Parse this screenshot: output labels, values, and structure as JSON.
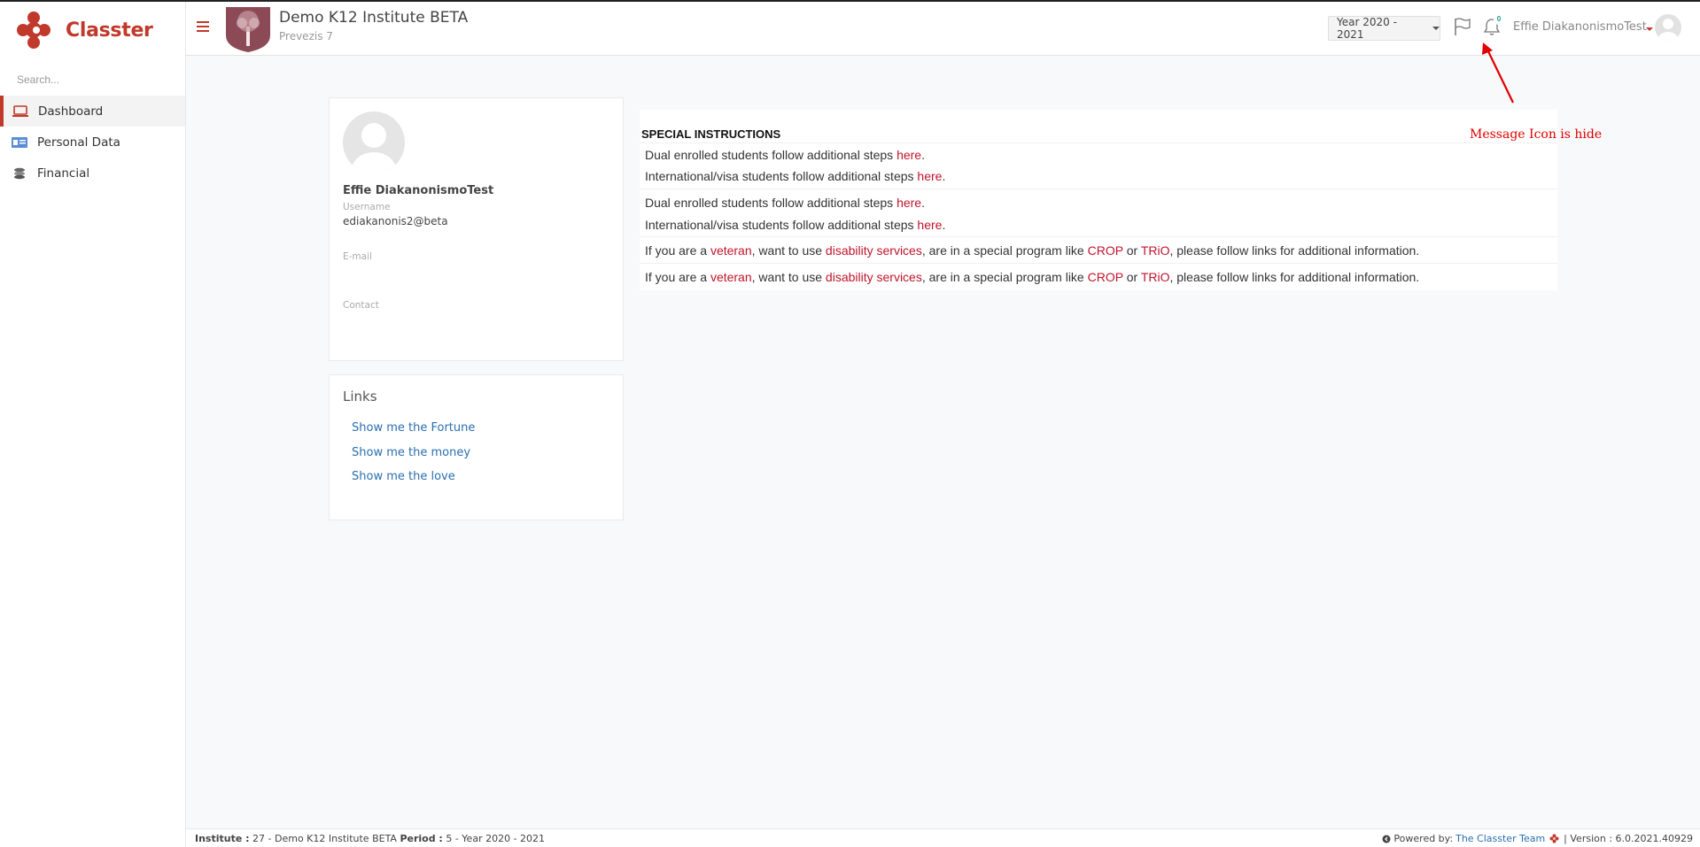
{
  "brand": {
    "name": "Classter"
  },
  "sidebar": {
    "search_placeholder": "Search...",
    "items": [
      {
        "label": "Dashboard",
        "icon": "laptop-icon",
        "active": true
      },
      {
        "label": "Personal Data",
        "icon": "id-card-icon",
        "active": false
      },
      {
        "label": "Financial",
        "icon": "coins-icon",
        "active": false
      }
    ]
  },
  "header": {
    "institute_name": "Demo K12 Institute BETA",
    "institute_address": "Prevezis 7",
    "year_selected": "Year 2020 - 2021",
    "notifications_count": "0",
    "user_name": "Effie DiakanonismoTest"
  },
  "profile": {
    "name": "Effie DiakanonismoTest",
    "username_label": "Username",
    "username": "ediakanonis2@beta",
    "email_label": "E-mail",
    "email": "",
    "contact_label": "Contact",
    "contact": ""
  },
  "links": {
    "title": "Links",
    "items": [
      "Show me the Fortune",
      "Show me the money",
      "Show me the love"
    ]
  },
  "instructions": {
    "title": "SPECIAL INSTRUCTIONS",
    "dual_text": "Dual enrolled students follow additional steps ",
    "intl_text": "International/visa students follow additional steps ",
    "here": "here",
    "dot": ".",
    "v_prefix": "If you are a ",
    "veteran": "veteran",
    "v_mid1": ", want to use ",
    "disability": "disability services",
    "v_mid2": ", are in a special program like ",
    "crop": "CROP",
    "or": " or ",
    "trio": "TRiO",
    "v_suffix": ", please follow links for additional information."
  },
  "annotation": {
    "text": "Message Icon is hide",
    "color": "#e00000"
  },
  "footer": {
    "institute_label": "Institute :",
    "institute_value": " 27 - Demo K12 Institute BETA ",
    "period_label": "Period :",
    "period_value": " 5 - Year 2020 - 2021",
    "powered_by": "Powered by:",
    "team": "The Classter Team",
    "version": "| Version : 6.0.2021.40929"
  },
  "colors": {
    "brand": "#c0392b",
    "link": "#2a6fb0",
    "instruction_link": "#c0142c"
  }
}
